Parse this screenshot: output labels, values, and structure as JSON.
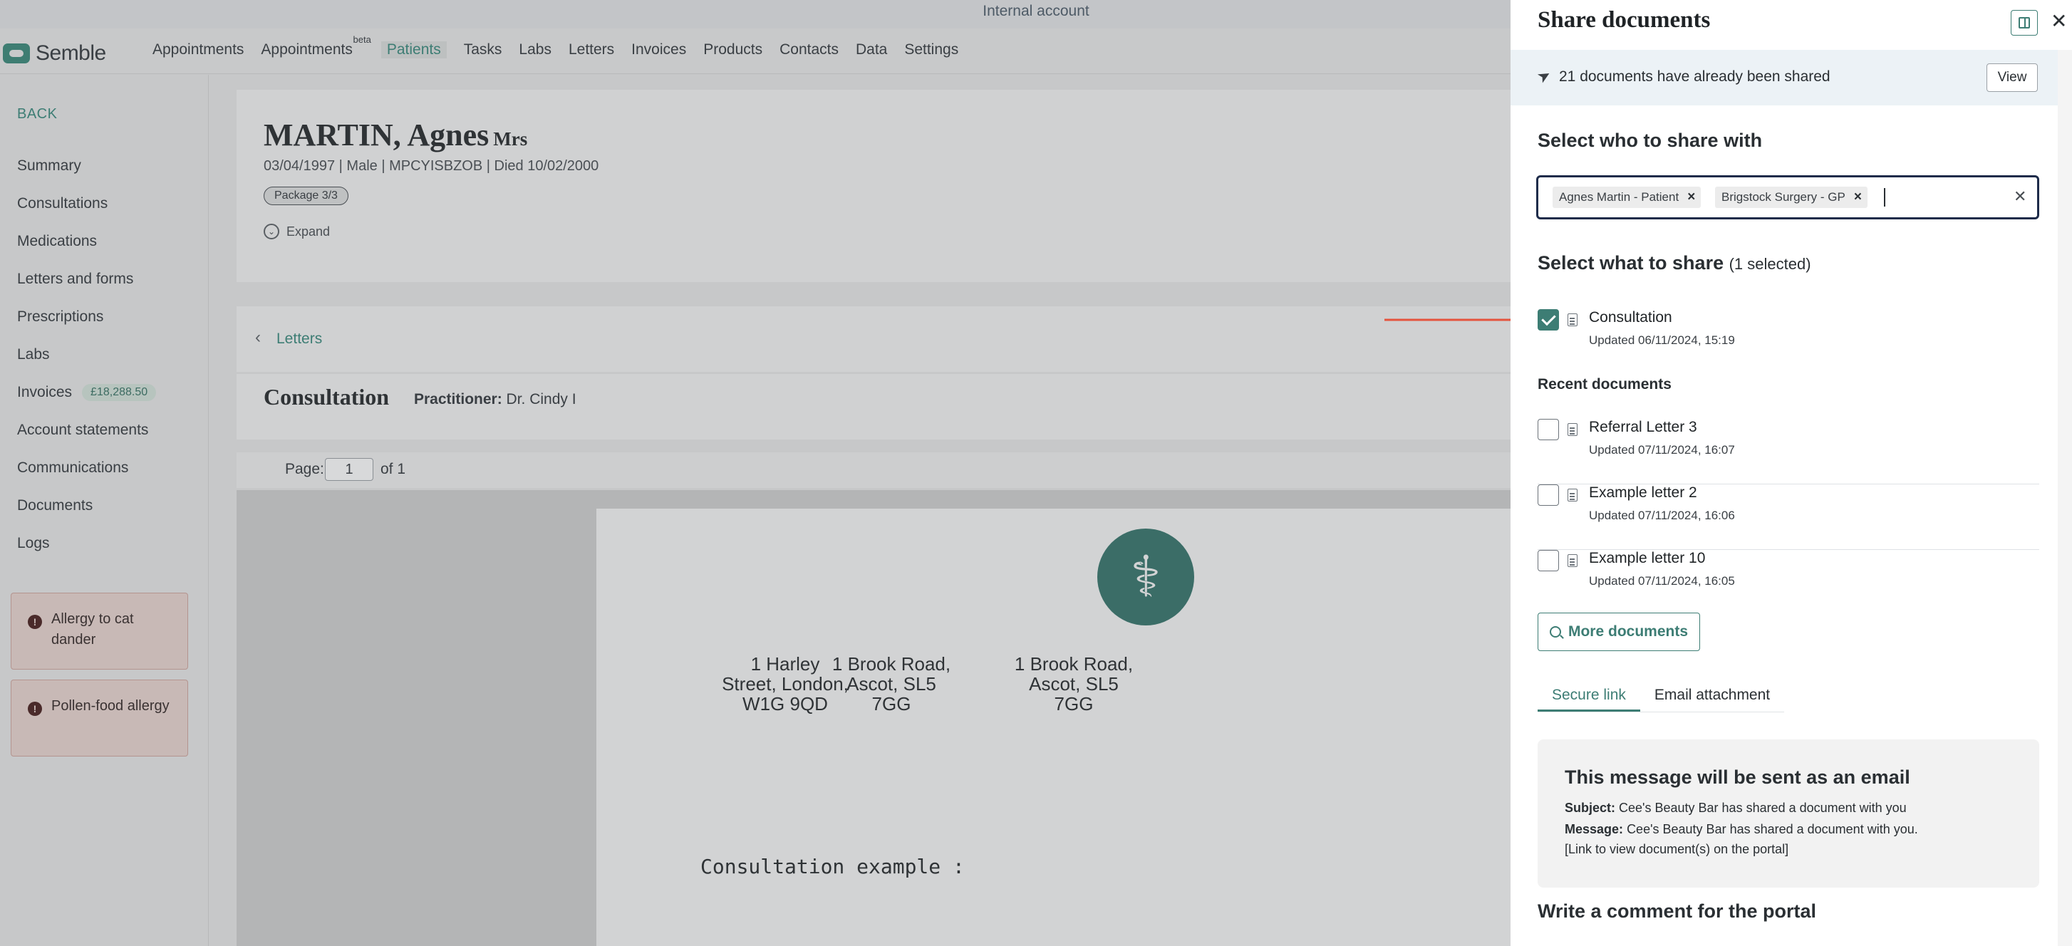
{
  "app": {
    "banner": "Internal account",
    "logo": "Semble",
    "nav": [
      {
        "label": "Appointments"
      },
      {
        "label": "Appointments",
        "sup": "beta"
      },
      {
        "label": "Patients",
        "active": true
      },
      {
        "label": "Tasks"
      },
      {
        "label": "Labs"
      },
      {
        "label": "Letters"
      },
      {
        "label": "Invoices"
      },
      {
        "label": "Products"
      },
      {
        "label": "Contacts"
      },
      {
        "label": "Data"
      },
      {
        "label": "Settings"
      }
    ]
  },
  "sidebar": {
    "back": "BACK",
    "items": [
      {
        "label": "Summary"
      },
      {
        "label": "Consultations"
      },
      {
        "label": "Medications"
      },
      {
        "label": "Letters and forms"
      },
      {
        "label": "Prescriptions"
      },
      {
        "label": "Labs"
      },
      {
        "label": "Invoices",
        "badge": "£18,288.50"
      },
      {
        "label": "Account statements"
      },
      {
        "label": "Communications"
      },
      {
        "label": "Documents"
      },
      {
        "label": "Logs"
      }
    ],
    "alerts": [
      "Allergy to cat dander",
      "Pollen-food allergy"
    ]
  },
  "patient": {
    "name": "MARTIN, Agnes",
    "title": "Mrs",
    "details": "03/04/1997  |  Male  |  MPCYISBZOB  |  Died 10/02/2000",
    "package": "Package 3/3",
    "expand": "Expand"
  },
  "letter": {
    "breadcrumb": "Letters",
    "title": "Consultation",
    "practitioner_label": "Practitioner:",
    "practitioner": "Dr. Cindy I",
    "page_label": "Page:",
    "page_value": "1",
    "page_of": "of 1",
    "addresses": [
      "1 Harley\nStreet, London,\nW1G 9QD",
      "1 Brook Road,\nAscot, SL5\n7GG",
      "1 Brook Road,\nAscot, SL5\n7GG"
    ],
    "body_heading": "Consultation example :"
  },
  "panel": {
    "title": "Share documents",
    "shared_text": "21 documents have already been shared",
    "view_label": "View",
    "who_heading": "Select who to share with",
    "recipients": [
      "Agnes Martin - Patient",
      "Brigstock Surgery - GP"
    ],
    "what_heading": "Select what to share",
    "what_count": "(1 selected)",
    "selected_doc": {
      "name": "Consultation",
      "updated": "Updated 06/11/2024, 15:19",
      "checked": true
    },
    "recent_heading": "Recent documents",
    "recent_docs": [
      {
        "name": "Referral Letter 3",
        "updated": "Updated 07/11/2024, 16:07",
        "checked": false
      },
      {
        "name": "Example letter 2",
        "updated": "Updated 07/11/2024, 16:06",
        "checked": false
      },
      {
        "name": "Example letter 10",
        "updated": "Updated 07/11/2024, 16:05",
        "checked": false
      }
    ],
    "more_label": "More documents",
    "tabs": [
      {
        "label": "Secure link",
        "active": true
      },
      {
        "label": "Email attachment",
        "active": false
      }
    ],
    "message": {
      "title": "This message will be sent as an email",
      "subject_label": "Subject:",
      "subject": "Cee's Beauty Bar has shared a document with you",
      "message_label": "Message:",
      "message": "Cee's Beauty Bar has shared a document with you.",
      "link_line": "[Link to view document(s) on the portal]"
    },
    "comment_heading": "Write a comment for the portal"
  },
  "colors": {
    "accent": "#3d7d74",
    "arrow": "#e5533d",
    "focus_border": "#1e2c4a"
  }
}
